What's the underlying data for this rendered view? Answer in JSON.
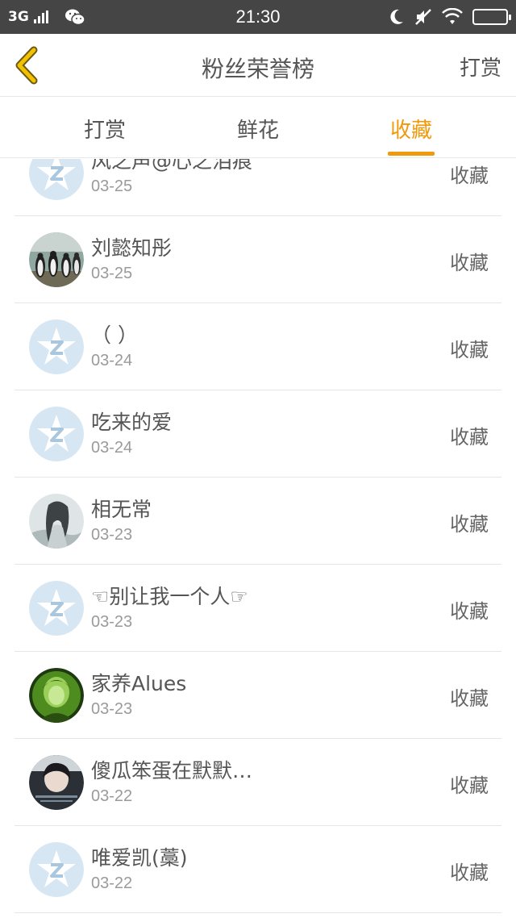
{
  "status_bar": {
    "network": "3G",
    "time": "21:30",
    "icons": [
      "signal-icon",
      "wechat-icon",
      "moon-icon",
      "mute-icon",
      "wifi-icon",
      "battery-icon"
    ]
  },
  "header": {
    "title": "粉丝荣誉榜",
    "action_label": "打赏",
    "back_icon": "chevron-left-icon",
    "accent_color": "#ef9a0c"
  },
  "tabs": [
    {
      "label": "打赏",
      "active": false
    },
    {
      "label": "鲜花",
      "active": false
    },
    {
      "label": "收藏",
      "active": true
    }
  ],
  "fans": [
    {
      "name": "风之声@心之泪痕",
      "date": "03-25",
      "action": "收藏",
      "avatar": "default-avatar"
    },
    {
      "name": "刘懿知彤",
      "date": "03-25",
      "action": "收藏",
      "avatar": "penguins-avatar"
    },
    {
      "name": "（ ）",
      "date": "03-24",
      "action": "收藏",
      "avatar": "default-avatar"
    },
    {
      "name": "吃来的爱",
      "date": "03-24",
      "action": "收藏",
      "avatar": "default-avatar"
    },
    {
      "name": "相无常",
      "date": "03-23",
      "action": "收藏",
      "avatar": "ink-painting-avatar"
    },
    {
      "name": "☜别让我一个人☞",
      "date": "03-23",
      "action": "收藏",
      "avatar": "default-avatar"
    },
    {
      "name": "家养Alues",
      "date": "03-23",
      "action": "收藏",
      "avatar": "green-portrait-avatar"
    },
    {
      "name": "傻瓜笨蛋在默默…",
      "date": "03-22",
      "action": "收藏",
      "avatar": "dark-portrait-avatar"
    },
    {
      "name": "唯爱凯(藁)",
      "date": "03-22",
      "action": "收藏",
      "avatar": "default-avatar"
    }
  ]
}
